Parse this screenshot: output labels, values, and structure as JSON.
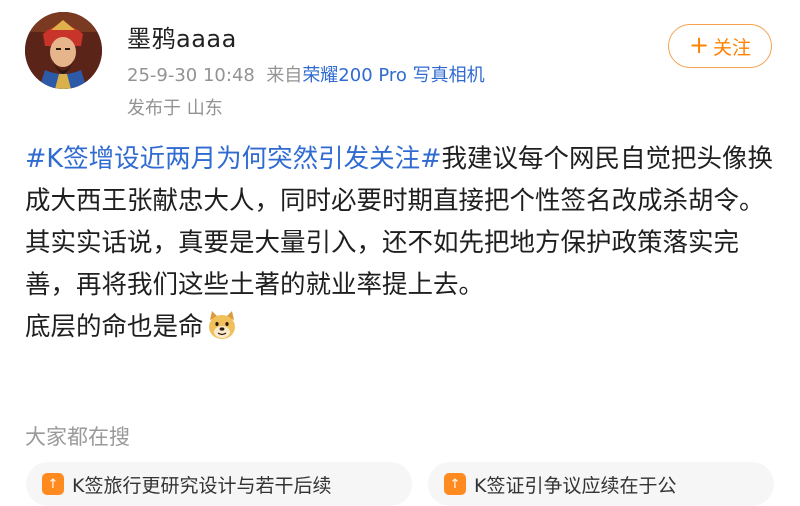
{
  "post": {
    "author": "墨鸦aaaa",
    "time": "25-9-30 10:48",
    "source_prefix": "来自",
    "device": "荣耀200 Pro 写真相机",
    "location": "发布于 山东",
    "follow_label": "关注",
    "paragraph1": {
      "hashtag": "#K签增设近两月为何突然引发关注#",
      "text": "我建议每个网民自觉把头像换成大西王张献忠大人，同时必要时期直接把个性签名改成杀胡令。"
    },
    "paragraph2": "其实实话说，真要是大量引入，还不如先把地方保护政策落实完善，再将我们这些土著的就业率提上去。",
    "paragraph3": "底层的命也是命"
  },
  "search": {
    "heading": "大家都在搜",
    "chips": [
      "K签旅行更研究设计与若干后续",
      "K签证引争议应续在于公"
    ]
  },
  "colors": {
    "link_blue": "#2f6bd1",
    "follow_orange": "#ff8200",
    "meta_gray": "#939393"
  },
  "icons": {
    "follow": "plus-icon",
    "emoji": "doge-emoji-icon",
    "chip": "trending-icon"
  }
}
